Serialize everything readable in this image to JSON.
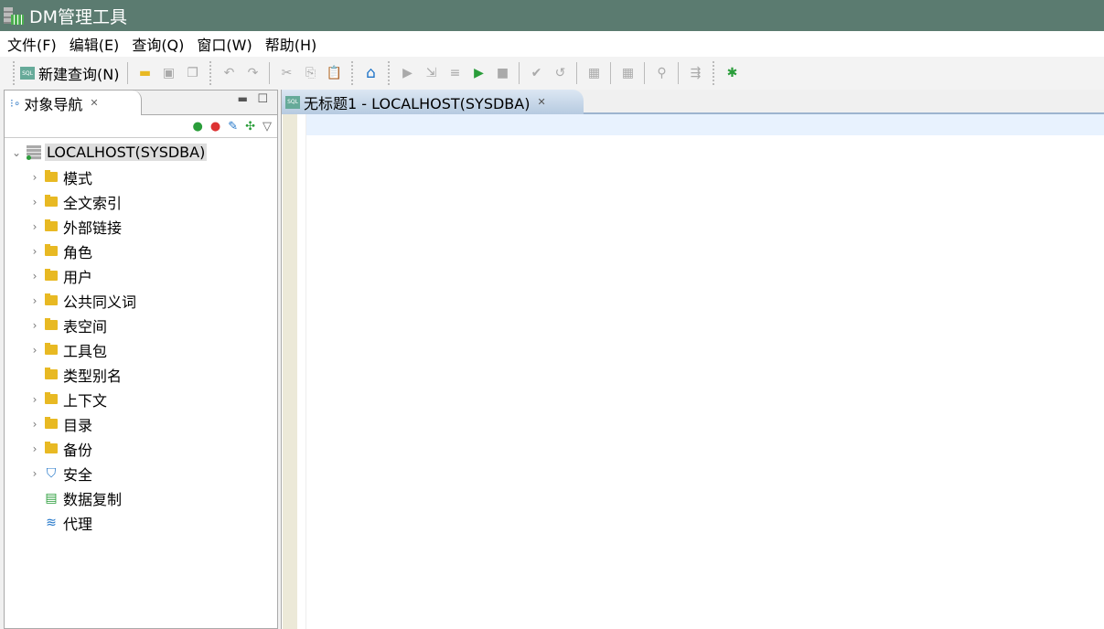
{
  "app": {
    "title": "DM管理工具"
  },
  "menu": [
    "文件(F)",
    "编辑(E)",
    "查询(Q)",
    "窗口(W)",
    "帮助(H)"
  ],
  "toolbar": {
    "new_query": "新建查询(N)"
  },
  "navigator": {
    "tab_label": "对象导航",
    "root": "LOCALHOST(SYSDBA)",
    "items": [
      {
        "label": "模式",
        "expandable": true,
        "icon": "folder-icon"
      },
      {
        "label": "全文索引",
        "expandable": true,
        "icon": "folder-icon"
      },
      {
        "label": "外部链接",
        "expandable": true,
        "icon": "folder-icon"
      },
      {
        "label": "角色",
        "expandable": true,
        "icon": "folder-icon"
      },
      {
        "label": "用户",
        "expandable": true,
        "icon": "folder-icon"
      },
      {
        "label": "公共同义词",
        "expandable": true,
        "icon": "folder-icon"
      },
      {
        "label": "表空间",
        "expandable": true,
        "icon": "folder-icon"
      },
      {
        "label": "工具包",
        "expandable": true,
        "icon": "folder-icon"
      },
      {
        "label": "类型别名",
        "expandable": false,
        "icon": "folder-icon"
      },
      {
        "label": "上下文",
        "expandable": true,
        "icon": "folder-icon"
      },
      {
        "label": "目录",
        "expandable": true,
        "icon": "folder-icon"
      },
      {
        "label": "备份",
        "expandable": true,
        "icon": "folder-icon"
      },
      {
        "label": "安全",
        "expandable": true,
        "icon": "shield-icon"
      },
      {
        "label": "数据复制",
        "expandable": false,
        "icon": "replication-icon"
      },
      {
        "label": "代理",
        "expandable": false,
        "icon": "layers-icon"
      }
    ]
  },
  "editor": {
    "tab_label": "无标题1 - LOCALHOST(SYSDBA)",
    "sql_badge": "SQL"
  }
}
